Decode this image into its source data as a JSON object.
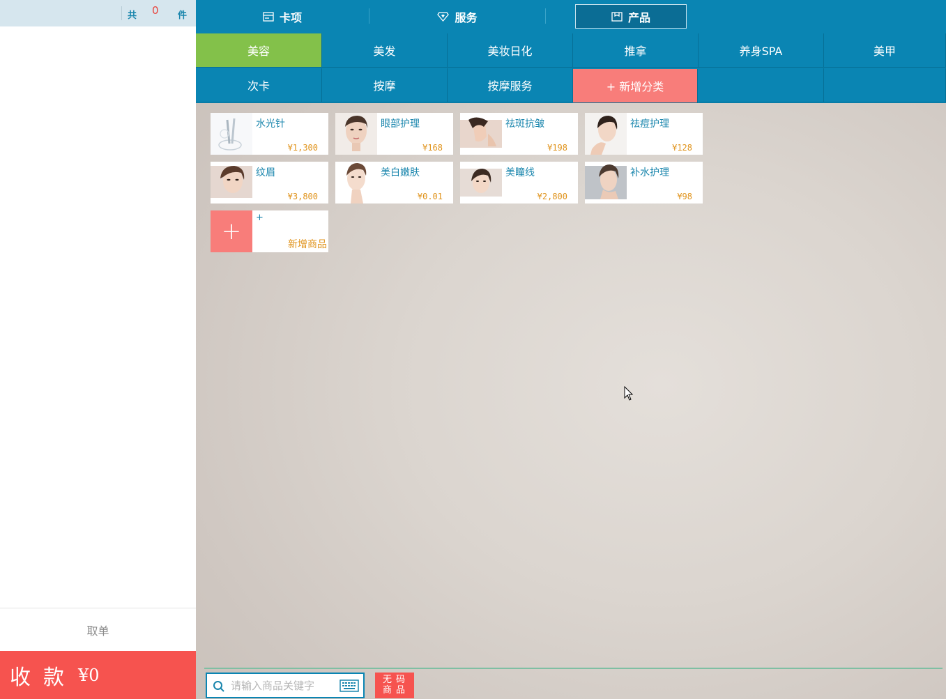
{
  "cart": {
    "total_prefix": "共",
    "count": "0",
    "unit": "件"
  },
  "cancel_label": "取单",
  "pay": {
    "label": "收款",
    "amount": "¥0"
  },
  "top_tabs": [
    {
      "label": "卡项",
      "icon": "card-icon"
    },
    {
      "label": "服务",
      "icon": "diamond-heart-icon"
    },
    {
      "label": "产品",
      "icon": "box-icon",
      "active": true
    }
  ],
  "categories": [
    {
      "label": "美容",
      "active": true
    },
    {
      "label": "美发"
    },
    {
      "label": "美妆日化"
    },
    {
      "label": "推拿"
    },
    {
      "label": "养身SPA"
    },
    {
      "label": "美甲"
    },
    {
      "label": "次卡"
    },
    {
      "label": "按摩"
    },
    {
      "label": "按摩服务"
    },
    {
      "label": "+ 新增分类",
      "add": true
    }
  ],
  "products": [
    {
      "name": "水光针",
      "price": "¥1,300"
    },
    {
      "name": "眼部护理",
      "price": "¥168"
    },
    {
      "name": "祛斑抗皱",
      "price": "¥198"
    },
    {
      "name": "祛痘护理",
      "price": "¥128"
    },
    {
      "name": "纹眉",
      "price": "¥3,800"
    },
    {
      "name": "美白嫩肤",
      "price": "¥0.01"
    },
    {
      "name": "美瞳线",
      "price": "¥2,800"
    },
    {
      "name": "补水护理",
      "price": "¥98"
    }
  ],
  "add_product": {
    "plus": "+",
    "small_plus": "+",
    "label": "新增商品"
  },
  "search": {
    "placeholder": "请输入商品关键字"
  },
  "no_code_button": {
    "line1": "无码",
    "line2": "商品"
  }
}
